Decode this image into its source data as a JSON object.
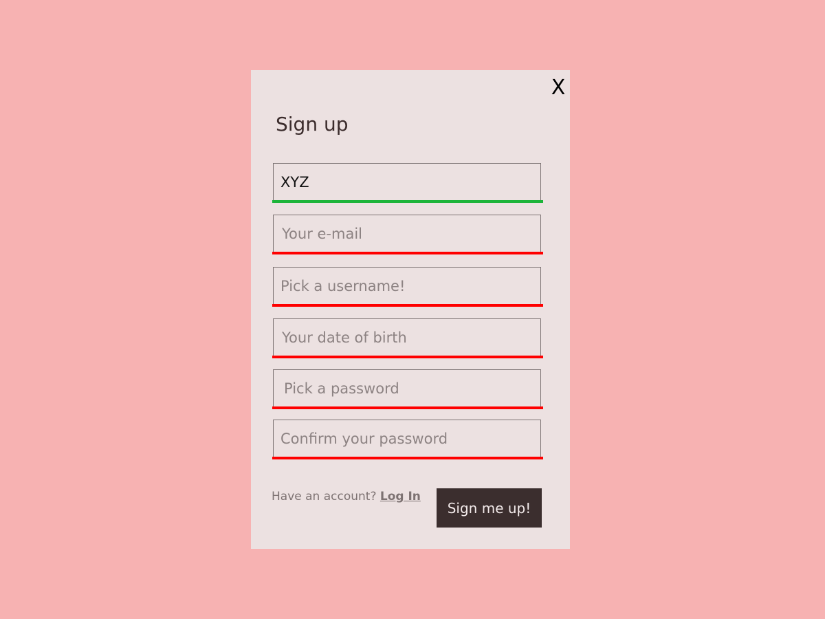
{
  "colors": {
    "page_background": "#f7b2b2",
    "modal_background": "#ece1e1",
    "valid_underline": "#1db43a",
    "invalid_underline": "#ff0000",
    "button_background": "#3b2e2e"
  },
  "modal": {
    "close_label": "X",
    "title": "Sign up",
    "fields": [
      {
        "value": "XYZ",
        "placeholder": "",
        "state": "valid"
      },
      {
        "value": "",
        "placeholder": "Your e-mail",
        "state": "invalid"
      },
      {
        "value": "",
        "placeholder": "Pick a username!",
        "state": "invalid"
      },
      {
        "value": "",
        "placeholder": "Your date of birth",
        "state": "invalid"
      },
      {
        "value": "",
        "placeholder": "Pick a password",
        "state": "invalid"
      },
      {
        "value": "",
        "placeholder": "Confirm your password",
        "state": "invalid"
      }
    ],
    "footer": {
      "have_account_text": "Have an account?",
      "login_link": "Log In",
      "submit_label": "Sign me up!"
    }
  }
}
